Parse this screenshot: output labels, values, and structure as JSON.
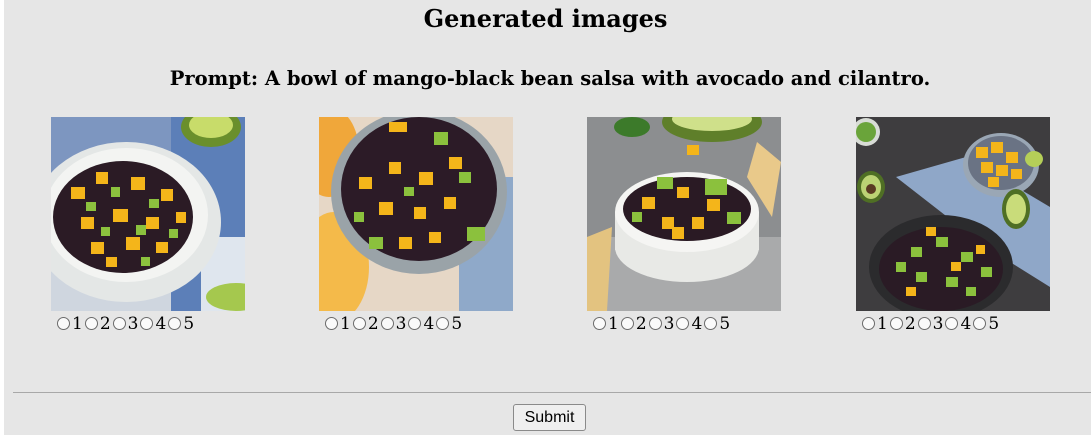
{
  "page": {
    "title": "Generated images",
    "prompt": "Prompt: A bowl of mango-black bean salsa with avocado and cilantro."
  },
  "images": [
    {
      "alt": "",
      "rating_options": [
        "1",
        "2",
        "3",
        "4",
        "5"
      ]
    },
    {
      "alt": "",
      "rating_options": [
        "1",
        "2",
        "3",
        "4",
        "5"
      ]
    },
    {
      "alt": "",
      "rating_options": [
        "1",
        "2",
        "3",
        "4",
        "5"
      ]
    },
    {
      "alt": "",
      "rating_options": [
        "1",
        "2",
        "3",
        "4",
        "5"
      ]
    }
  ],
  "form": {
    "submit_label": "Submit"
  },
  "colors": {
    "panel_background": "#e6e6e6",
    "mango": "#f5b81c",
    "avocado": "#8bbf3a",
    "black_bean": "#2a1a24",
    "bowl": "#eef0ee"
  }
}
